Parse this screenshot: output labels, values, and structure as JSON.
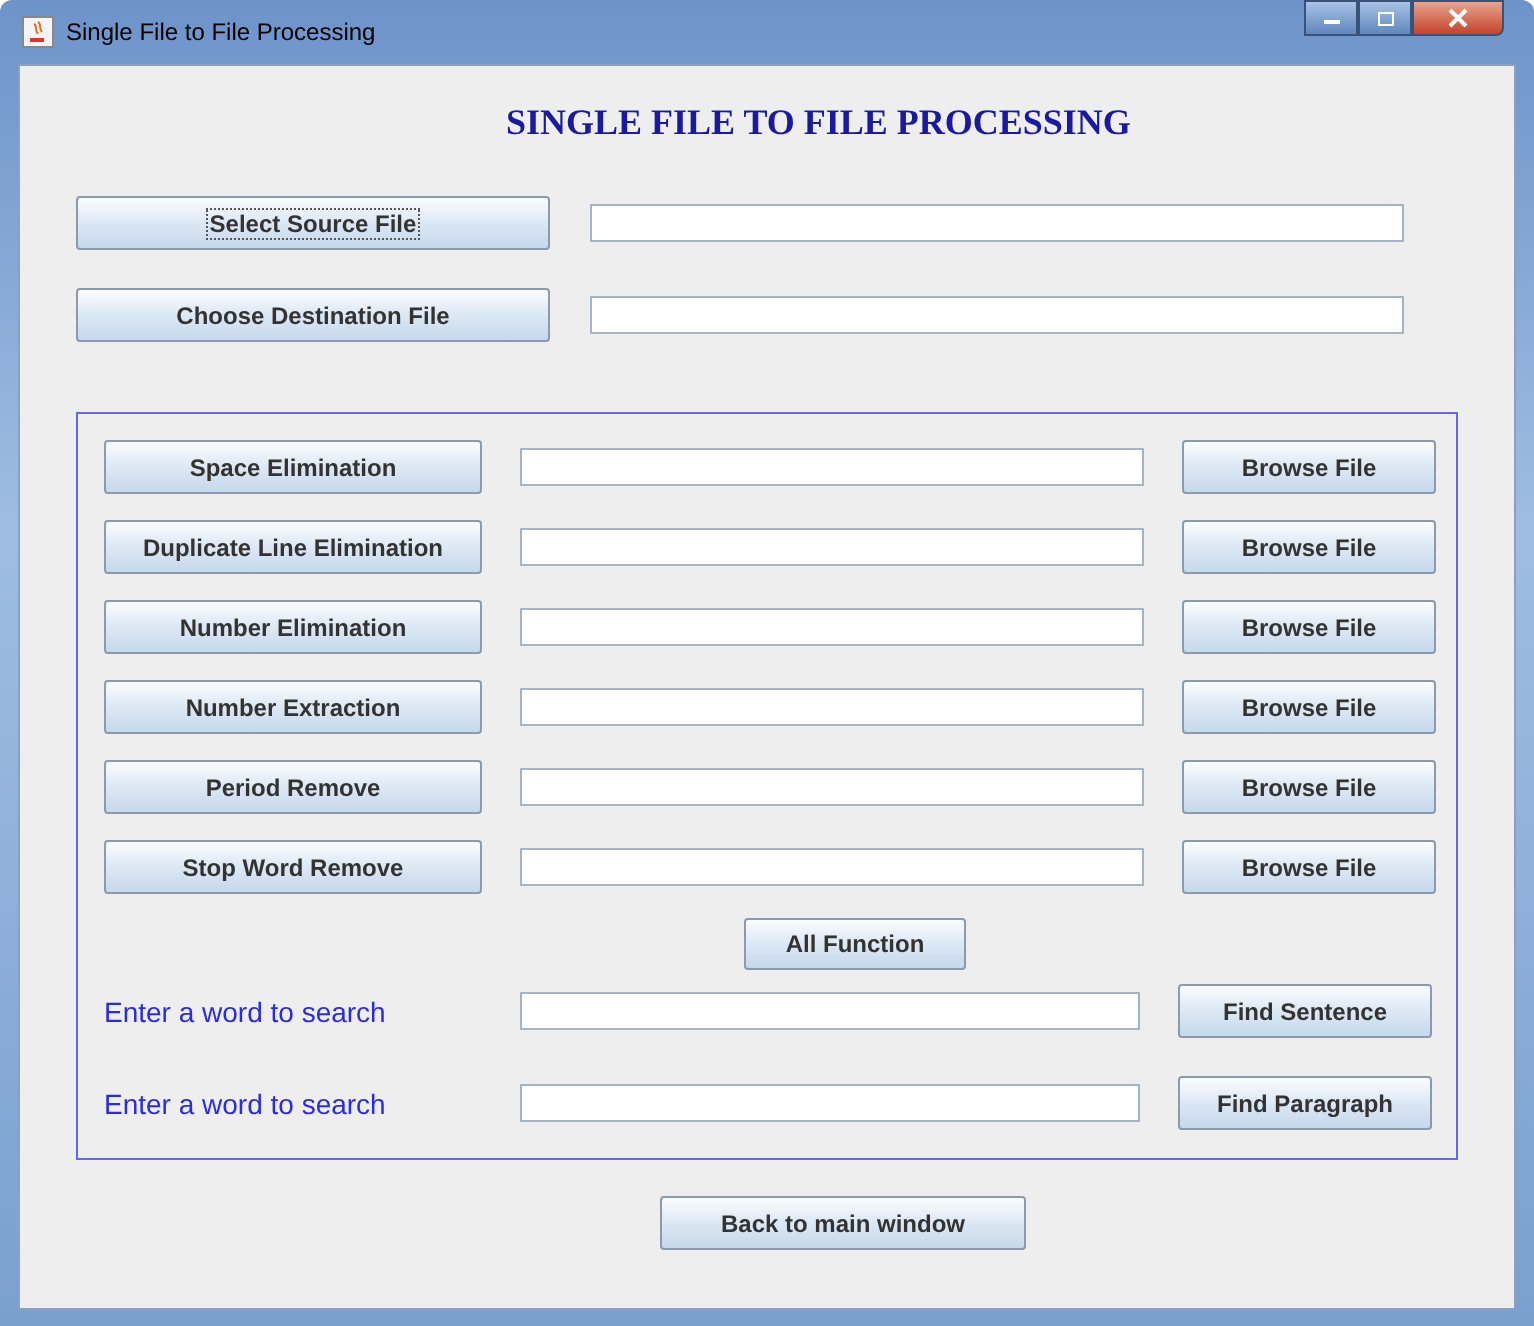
{
  "window": {
    "title": "Single File to File Processing"
  },
  "heading": "SINGLE FILE TO FILE PROCESSING",
  "file_rows": [
    {
      "button": "Select Source File",
      "focused": true
    },
    {
      "button": "Choose Destination File",
      "focused": false
    }
  ],
  "operations": [
    {
      "button": "Space Elimination",
      "browse": "Browse File"
    },
    {
      "button": "Duplicate Line Elimination",
      "browse": "Browse File"
    },
    {
      "button": "Number Elimination",
      "browse": "Browse File"
    },
    {
      "button": "Number Extraction",
      "browse": "Browse File"
    },
    {
      "button": "Period Remove",
      "browse": "Browse File"
    },
    {
      "button": "Stop Word Remove",
      "browse": "Browse File"
    }
  ],
  "all_function": "All Function",
  "searches": [
    {
      "label": "Enter a word to search",
      "button": "Find Sentence"
    },
    {
      "label": "Enter a word to search",
      "button": "Find Paragraph"
    }
  ],
  "back_button": "Back to main window"
}
